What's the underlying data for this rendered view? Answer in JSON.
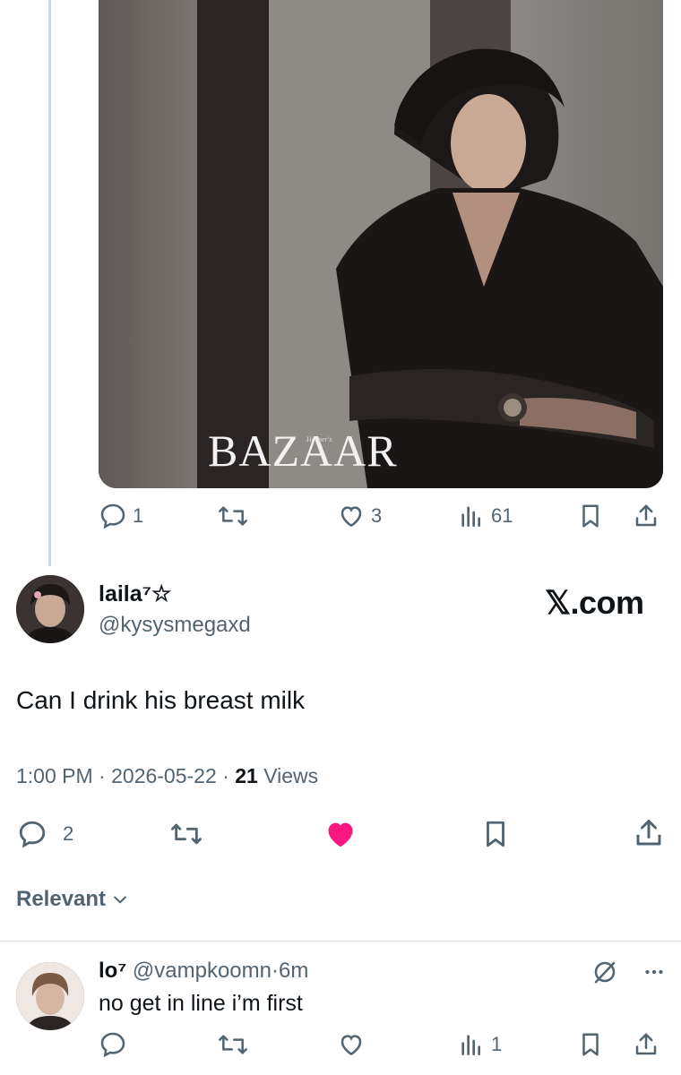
{
  "photo": {
    "brand": "BAZAAR",
    "brand_small": "Harper's"
  },
  "top_actions": {
    "replies": "1",
    "retweets": "",
    "likes": "3",
    "views": "61"
  },
  "tweet": {
    "display_name": "laila⁷☆",
    "handle": "@kysysmegaxd",
    "watermark": "𝕏.com",
    "text": "Can I drink his breast milk",
    "time": "1:00 PM",
    "date": "2026-05-22",
    "views_count": "21",
    "views_label": "Views",
    "replies": "2"
  },
  "sort": {
    "label": "Relevant"
  },
  "reply": {
    "display_name": "lo⁷",
    "handle": "@vampkoomn",
    "age": "6m",
    "text": "no get in line i’m first",
    "views": "1"
  },
  "colors": {
    "like_active": "#f91880",
    "muted": "#536471",
    "thread_line": "#cfd9de"
  }
}
